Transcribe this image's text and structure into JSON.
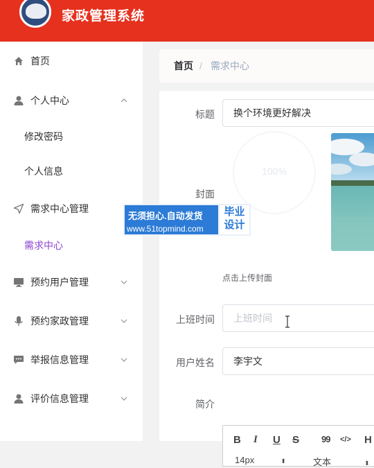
{
  "app": {
    "title": "家政管理系统"
  },
  "sidebar": {
    "items": [
      {
        "label": "首页",
        "icon": "home-icon"
      },
      {
        "label": "个人中心",
        "icon": "user-icon",
        "expanded": true,
        "children": [
          {
            "label": "修改密码"
          },
          {
            "label": "个人信息"
          }
        ]
      },
      {
        "label": "需求中心管理",
        "icon": "send-icon",
        "expanded": true,
        "children": [
          {
            "label": "需求中心",
            "active": true
          }
        ]
      },
      {
        "label": "预约用户管理",
        "icon": "monitor-icon"
      },
      {
        "label": "预约家政管理",
        "icon": "microphone-icon"
      },
      {
        "label": "举报信息管理",
        "icon": "chat-icon"
      },
      {
        "label": "评价信息管理",
        "icon": "user-icon"
      }
    ]
  },
  "breadcrumb": {
    "home": "首页",
    "separator": "/",
    "current": "需求中心"
  },
  "form": {
    "title": {
      "label": "标题",
      "value": "换个环境更好解决"
    },
    "cover": {
      "label": "封面",
      "progress_text": "100%",
      "hint": "点击上传封面"
    },
    "work_time": {
      "label": "上班时间",
      "placeholder": "上班时间"
    },
    "user_name": {
      "label": "用户姓名",
      "value": "李宇文"
    },
    "intro": {
      "label": "简介",
      "toolbar": {
        "bold": "B",
        "italic": "I",
        "underline": "U",
        "strike": "S",
        "quote": "99",
        "code": "</>",
        "header": "H",
        "size": "14px",
        "style": "文本"
      }
    }
  },
  "watermark": {
    "line1": "无须担心.自动发货",
    "line2": "www.51topmind.com",
    "badge_line1": "毕业",
    "badge_line2": "设计"
  },
  "colors": {
    "header": "#e5311e",
    "active": "#8b44d0",
    "watermark": "#2c7bd6"
  }
}
